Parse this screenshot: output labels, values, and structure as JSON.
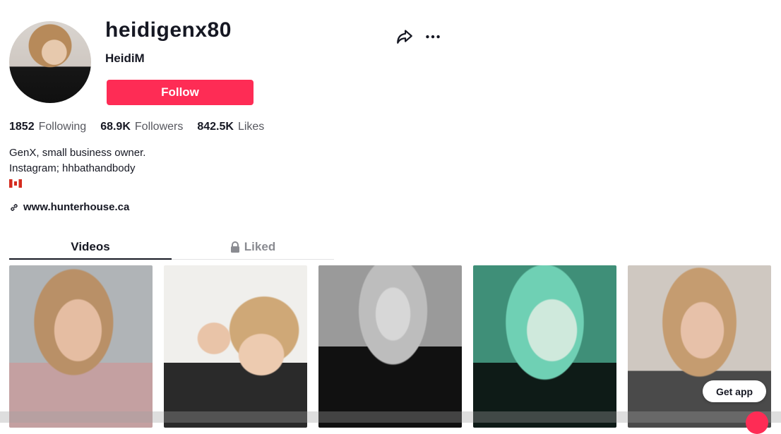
{
  "profile": {
    "username": "heidigenx80",
    "nickname": "HeidiM",
    "follow_label": "Follow",
    "stats": [
      {
        "value": "1852",
        "label": "Following"
      },
      {
        "value": "68.9K",
        "label": "Followers"
      },
      {
        "value": "842.5K",
        "label": "Likes"
      }
    ],
    "bio_lines": [
      "GenX, small business owner.",
      "Instagram; hhbathandbody"
    ],
    "link": "www.hunterhouse.ca"
  },
  "tabs": {
    "videos": "Videos",
    "liked": "Liked"
  },
  "floating": {
    "get_app": "Get app"
  },
  "colors": {
    "accent": "#fe2c55"
  }
}
